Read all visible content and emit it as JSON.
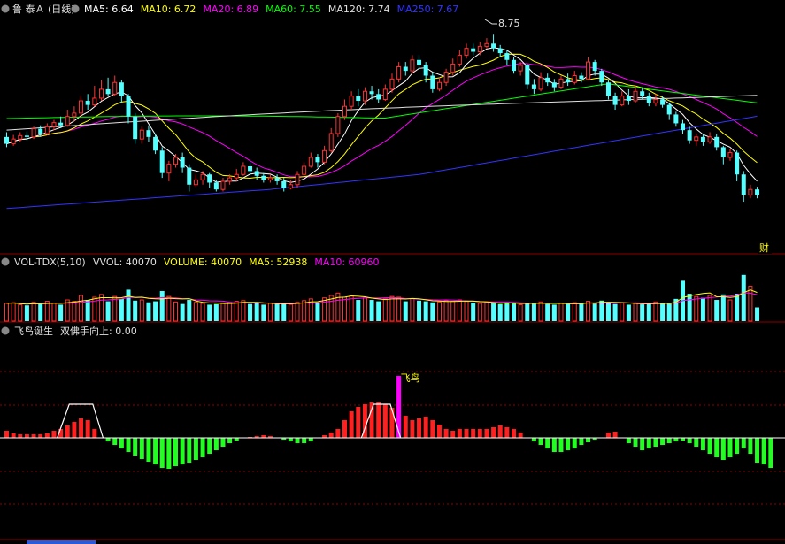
{
  "price_header": {
    "title": "鲁 泰Ａ (日线)",
    "items": [
      {
        "label": "MA5: 6.64",
        "color": "#ffffff"
      },
      {
        "label": "MA10: 6.72",
        "color": "#ffff00"
      },
      {
        "label": "MA20: 6.89",
        "color": "#ff00ff"
      },
      {
        "label": "MA60: 7.55",
        "color": "#00ff00"
      },
      {
        "label": "MA120: 7.74",
        "color": "#e0e0e0"
      },
      {
        "label": "MA250: 7.67",
        "color": "#3333ff"
      }
    ]
  },
  "max_marker": "8.75",
  "cai_badge": "财",
  "vol_header": {
    "title": "VOL-TDX(5,10)",
    "items": [
      {
        "label": "VVOL: 40070",
        "color": "#e0e0e0"
      },
      {
        "label": "VOLUME: 40070",
        "color": "#ffff00"
      },
      {
        "label": "MA5: 52938",
        "color": "#ffff00"
      },
      {
        "label": "MA10: 60960",
        "color": "#ff00ff"
      }
    ]
  },
  "ind_header": {
    "title": "飞鸟诞生",
    "items": [
      {
        "label": "双佛手向上: 0.00",
        "color": "#e0e0e0"
      }
    ]
  },
  "signal_label": "飞鸟",
  "colors": {
    "up": "#ff3232",
    "down": "#54ffff",
    "ma5": "#ffffff",
    "ma10": "#ffff00",
    "ma20": "#ff00ff",
    "ma60": "#00ff00",
    "ma120": "#e0e0e0",
    "ma250": "#3333ff",
    "grid": "#8b0000",
    "hist_pos": "#ff2020",
    "hist_neg": "#20ff20",
    "signal": "#ff00ff",
    "signal_text": "#ffff00"
  },
  "chart_data": [
    {
      "type": "candlestick",
      "title": "鲁 泰Ａ (日线)",
      "ylim": [
        5.6,
        9.0
      ],
      "annotated_high": 8.75,
      "candles": [
        [
          7.25,
          7.15,
          7.32,
          7.1
        ],
        [
          7.15,
          7.22,
          7.28,
          7.12
        ],
        [
          7.22,
          7.27,
          7.32,
          7.18
        ],
        [
          7.27,
          7.25,
          7.33,
          7.2
        ],
        [
          7.25,
          7.37,
          7.4,
          7.22
        ],
        [
          7.37,
          7.3,
          7.42,
          7.25
        ],
        [
          7.3,
          7.4,
          7.45,
          7.28
        ],
        [
          7.4,
          7.46,
          7.5,
          7.35
        ],
        [
          7.46,
          7.42,
          7.55,
          7.38
        ],
        [
          7.42,
          7.55,
          7.65,
          7.4
        ],
        [
          7.55,
          7.6,
          7.7,
          7.48
        ],
        [
          7.6,
          7.78,
          7.85,
          7.55
        ],
        [
          7.78,
          7.72,
          7.88,
          7.65
        ],
        [
          7.72,
          7.82,
          8.0,
          7.7
        ],
        [
          7.82,
          7.95,
          8.08,
          7.78
        ],
        [
          7.95,
          7.88,
          8.12,
          7.85
        ],
        [
          7.88,
          8.05,
          8.15,
          7.85
        ],
        [
          8.05,
          7.85,
          8.08,
          7.75
        ],
        [
          7.85,
          7.55,
          7.88,
          7.45
        ],
        [
          7.55,
          7.22,
          7.6,
          7.15
        ],
        [
          7.22,
          7.35,
          7.4,
          7.15
        ],
        [
          7.35,
          7.25,
          7.42,
          7.18
        ],
        [
          7.25,
          7.05,
          7.3,
          7.0
        ],
        [
          7.05,
          6.72,
          7.1,
          6.65
        ],
        [
          6.72,
          6.85,
          6.9,
          6.6
        ],
        [
          6.85,
          6.95,
          7.0,
          6.8
        ],
        [
          6.95,
          6.8,
          7.02,
          6.72
        ],
        [
          6.8,
          6.55,
          6.85,
          6.45
        ],
        [
          6.55,
          6.62,
          6.7,
          6.52
        ],
        [
          6.62,
          6.7,
          6.75,
          6.55
        ],
        [
          6.7,
          6.58,
          6.72,
          6.5
        ],
        [
          6.58,
          6.48,
          6.62,
          6.45
        ],
        [
          6.48,
          6.6,
          6.65,
          6.45
        ],
        [
          6.6,
          6.65,
          6.7,
          6.55
        ],
        [
          6.65,
          6.7,
          6.78,
          6.6
        ],
        [
          6.7,
          6.82,
          6.88,
          6.68
        ],
        [
          6.82,
          6.75,
          6.88,
          6.7
        ],
        [
          6.75,
          6.68,
          6.8,
          6.62
        ],
        [
          6.68,
          6.62,
          6.72,
          6.58
        ],
        [
          6.62,
          6.65,
          6.7,
          6.58
        ],
        [
          6.65,
          6.6,
          6.7,
          6.55
        ],
        [
          6.6,
          6.5,
          6.65,
          6.45
        ],
        [
          6.5,
          6.55,
          6.62,
          6.48
        ],
        [
          6.55,
          6.7,
          6.75,
          6.5
        ],
        [
          6.7,
          6.82,
          6.88,
          6.68
        ],
        [
          6.82,
          6.95,
          7.02,
          6.8
        ],
        [
          6.95,
          6.88,
          7.0,
          6.8
        ],
        [
          6.88,
          7.05,
          7.12,
          6.85
        ],
        [
          7.05,
          7.3,
          7.38,
          7.02
        ],
        [
          7.3,
          7.55,
          7.6,
          7.25
        ],
        [
          7.55,
          7.7,
          7.8,
          7.5
        ],
        [
          7.7,
          7.85,
          7.92,
          7.65
        ],
        [
          7.85,
          7.78,
          7.95,
          7.7
        ],
        [
          7.78,
          7.92,
          7.98,
          7.72
        ],
        [
          7.92,
          7.88,
          8.0,
          7.8
        ],
        [
          7.88,
          7.8,
          7.95,
          7.75
        ],
        [
          7.8,
          7.95,
          8.02,
          7.78
        ],
        [
          7.95,
          8.1,
          8.18,
          7.9
        ],
        [
          8.1,
          8.28,
          8.35,
          8.05
        ],
        [
          8.28,
          8.22,
          8.35,
          8.15
        ],
        [
          8.22,
          8.38,
          8.45,
          8.18
        ],
        [
          8.38,
          8.3,
          8.45,
          8.25
        ],
        [
          8.3,
          8.15,
          8.35,
          8.05
        ],
        [
          8.15,
          7.95,
          8.2,
          7.9
        ],
        [
          7.95,
          8.05,
          8.12,
          7.92
        ],
        [
          8.05,
          8.2,
          8.25,
          8.0
        ],
        [
          8.2,
          8.32,
          8.4,
          8.15
        ],
        [
          8.32,
          8.45,
          8.52,
          8.28
        ],
        [
          8.45,
          8.55,
          8.62,
          8.4
        ],
        [
          8.55,
          8.5,
          8.62,
          8.45
        ],
        [
          8.5,
          8.58,
          8.65,
          8.45
        ],
        [
          8.58,
          8.62,
          8.7,
          8.55
        ],
        [
          8.62,
          8.55,
          8.75,
          8.5
        ],
        [
          8.55,
          8.48,
          8.6,
          8.42
        ],
        [
          8.48,
          8.38,
          8.52,
          8.3
        ],
        [
          8.38,
          8.22,
          8.42,
          8.18
        ],
        [
          8.22,
          8.3,
          8.35,
          8.15
        ],
        [
          8.3,
          8.02,
          8.32,
          7.95
        ],
        [
          8.02,
          7.95,
          8.1,
          7.88
        ],
        [
          7.95,
          8.12,
          8.2,
          7.92
        ],
        [
          8.12,
          8.05,
          8.18,
          8.0
        ],
        [
          8.05,
          7.98,
          8.1,
          7.92
        ],
        [
          7.98,
          8.1,
          8.15,
          7.95
        ],
        [
          8.1,
          8.05,
          8.18,
          8.0
        ],
        [
          8.05,
          8.15,
          8.22,
          8.02
        ],
        [
          8.15,
          8.1,
          8.2,
          8.05
        ],
        [
          8.1,
          8.35,
          8.42,
          8.08
        ],
        [
          8.35,
          8.22,
          8.38,
          8.15
        ],
        [
          8.22,
          8.05,
          8.25,
          8.0
        ],
        [
          8.05,
          7.85,
          8.08,
          7.8
        ],
        [
          7.85,
          7.72,
          7.9,
          7.65
        ],
        [
          7.72,
          7.85,
          7.92,
          7.7
        ],
        [
          7.85,
          7.78,
          7.95,
          7.72
        ],
        [
          7.78,
          7.92,
          8.0,
          7.75
        ],
        [
          7.92,
          7.85,
          7.98,
          7.8
        ],
        [
          7.85,
          7.75,
          7.9,
          7.7
        ],
        [
          7.75,
          7.8,
          7.88,
          7.7
        ],
        [
          7.8,
          7.72,
          7.85,
          7.68
        ],
        [
          7.72,
          7.58,
          7.75,
          7.5
        ],
        [
          7.58,
          7.45,
          7.62,
          7.4
        ],
        [
          7.45,
          7.35,
          7.5,
          7.3
        ],
        [
          7.35,
          7.2,
          7.4,
          7.15
        ],
        [
          7.2,
          7.25,
          7.3,
          7.12
        ],
        [
          7.25,
          7.18,
          7.3,
          7.12
        ],
        [
          7.18,
          7.25,
          7.32,
          7.15
        ],
        [
          7.25,
          7.1,
          7.3,
          7.05
        ],
        [
          7.1,
          6.95,
          7.12,
          6.85
        ],
        [
          6.95,
          7.02,
          7.08,
          6.9
        ],
        [
          7.02,
          6.7,
          7.05,
          6.6
        ],
        [
          6.7,
          6.4,
          6.75,
          6.3
        ],
        [
          6.4,
          6.48,
          6.55,
          6.35
        ],
        [
          6.48,
          6.4,
          6.52,
          6.35
        ]
      ]
    },
    {
      "type": "bar",
      "title": "VOL-TDX(5,10)",
      "ylim": [
        0,
        150000
      ],
      "up_flags": [
        1,
        1,
        1,
        0,
        1,
        0,
        1,
        1,
        0,
        1,
        1,
        1,
        0,
        1,
        1,
        0,
        1,
        0,
        0,
        0,
        1,
        0,
        0,
        0,
        1,
        1,
        0,
        0,
        1,
        1,
        0,
        0,
        1,
        1,
        1,
        1,
        0,
        0,
        0,
        1,
        0,
        0,
        1,
        1,
        1,
        1,
        0,
        1,
        1,
        1,
        1,
        1,
        0,
        1,
        0,
        0,
        1,
        1,
        1,
        0,
        1,
        0,
        0,
        0,
        1,
        1,
        1,
        1,
        1,
        0,
        1,
        1,
        0,
        0,
        0,
        0,
        1,
        0,
        0,
        1,
        0,
        0,
        1,
        0,
        1,
        0,
        1,
        0,
        0,
        0,
        0,
        1,
        0,
        1,
        0,
        0,
        1,
        0,
        0,
        0,
        0,
        0,
        1,
        0,
        1,
        0,
        0,
        1,
        0,
        0,
        1,
        0
      ],
      "values": [
        52000,
        54000,
        48000,
        46000,
        55000,
        50000,
        58000,
        52000,
        48000,
        62000,
        58000,
        75000,
        62000,
        70000,
        78000,
        58000,
        72000,
        65000,
        92000,
        60000,
        62000,
        55000,
        58000,
        88000,
        72000,
        56000,
        50000,
        62000,
        55000,
        52000,
        48000,
        50000,
        52000,
        55000,
        58000,
        60000,
        50000,
        52000,
        48000,
        53000,
        50000,
        52000,
        49000,
        55000,
        60000,
        65000,
        55000,
        68000,
        75000,
        82000,
        70000,
        74000,
        62000,
        68000,
        62000,
        58000,
        65000,
        72000,
        70000,
        58000,
        66000,
        60000,
        58000,
        55000,
        56000,
        60000,
        58000,
        62000,
        58000,
        54000,
        52000,
        56000,
        52000,
        50000,
        55000,
        52000,
        48000,
        53000,
        52000,
        56000,
        50000,
        48000,
        52000,
        50000,
        54000,
        52000,
        58000,
        52000,
        60000,
        55000,
        50000,
        54000,
        48000,
        52000,
        49000,
        50000,
        56000,
        52000,
        53000,
        65000,
        118000,
        80000,
        72000,
        68000,
        75000,
        62000,
        78000,
        62000,
        80000,
        135000,
        102000,
        40070
      ]
    },
    {
      "type": "bar",
      "title": "飞鸟诞生",
      "ylim": [
        -50,
        100
      ],
      "values": [
        8,
        5,
        4,
        4,
        4,
        4,
        5,
        8,
        10,
        14,
        18,
        22,
        20,
        10,
        0,
        -4,
        -8,
        -12,
        -16,
        -20,
        -24,
        -27,
        -30,
        -34,
        -35,
        -32,
        -30,
        -28,
        -25,
        -22,
        -18,
        -14,
        -10,
        -6,
        -3,
        0,
        1,
        2,
        3,
        2,
        0,
        -2,
        -4,
        -6,
        -6,
        -4,
        0,
        3,
        6,
        10,
        20,
        30,
        35,
        38,
        40,
        40,
        38,
        34,
        70,
        25,
        20,
        22,
        24,
        20,
        15,
        10,
        8,
        10,
        10,
        10,
        10,
        10,
        12,
        14,
        12,
        10,
        6,
        0,
        -4,
        -8,
        -12,
        -16,
        -16,
        -14,
        -12,
        -8,
        -5,
        -2,
        0,
        6,
        7,
        0,
        -6,
        -10,
        -14,
        -12,
        -10,
        -8,
        -6,
        -4,
        -3,
        -6,
        -10,
        -14,
        -18,
        -22,
        -25,
        -22,
        -18,
        -12,
        -18,
        -28,
        -30,
        -34
      ]
    }
  ]
}
